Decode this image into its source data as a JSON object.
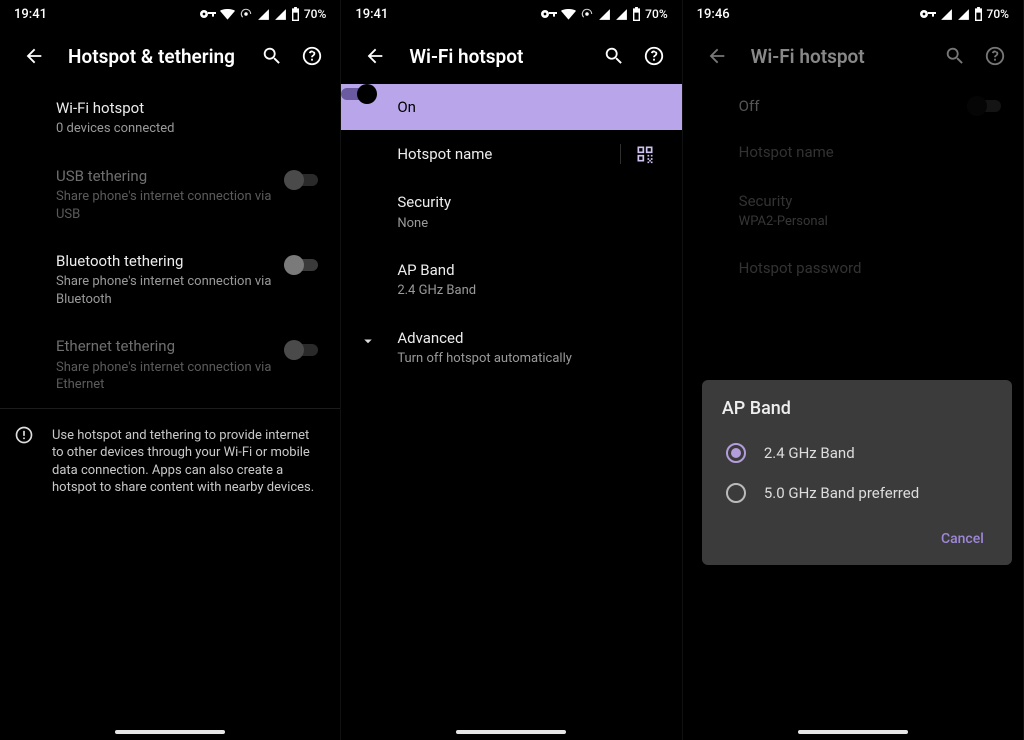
{
  "status_sets": [
    {
      "time": "19:41",
      "battery": "70%",
      "has_vpn": true,
      "has_hotspot": true
    },
    {
      "time": "19:41",
      "battery": "70%",
      "has_vpn": true,
      "has_hotspot": true
    },
    {
      "time": "19:46",
      "battery": "70%",
      "has_vpn": true,
      "has_hotspot": false
    }
  ],
  "screens": [
    {
      "title": "Hotspot & tethering",
      "items": [
        {
          "primary": "Wi-Fi hotspot",
          "secondary": "0 devices connected",
          "hasSwitch": false,
          "disabled": false
        },
        {
          "primary": "USB tethering",
          "secondary": "Share phone's internet connection via USB",
          "hasSwitch": true,
          "switchOn": false,
          "disabled": true
        },
        {
          "primary": "Bluetooth tethering",
          "secondary": "Share phone's internet connection via Bluetooth",
          "hasSwitch": true,
          "switchOn": false,
          "disabled": false
        },
        {
          "primary": "Ethernet tethering",
          "secondary": "Share phone's internet connection via Ethernet",
          "hasSwitch": true,
          "switchOn": false,
          "disabled": true
        }
      ],
      "info_text": "Use hotspot and tethering to provide internet to other devices through your Wi-Fi or mobile data connection. Apps can also create a hotspot to share content with nearby devices."
    },
    {
      "title": "Wi-Fi hotspot",
      "toggle": {
        "label": "On",
        "on": true
      },
      "items": [
        {
          "primary": "Hotspot name",
          "secondary": "",
          "trailing_qr": true
        },
        {
          "primary": "Security",
          "secondary": "None"
        },
        {
          "primary": "AP Band",
          "secondary": "2.4 GHz Band"
        },
        {
          "primary": "Advanced",
          "secondary": "Turn off hotspot automatically",
          "expand": true
        }
      ]
    },
    {
      "title": "Wi-Fi hotspot",
      "toggle": {
        "label": "Off",
        "on": false
      },
      "items": [
        {
          "primary": "Hotspot name",
          "secondary": ""
        },
        {
          "primary": "Security",
          "secondary": "WPA2-Personal"
        },
        {
          "primary": "Hotspot password",
          "secondary": ""
        }
      ],
      "dialog": {
        "title": "AP Band",
        "options": [
          "2.4 GHz Band",
          "5.0 GHz Band preferred"
        ],
        "selected": 0,
        "cancel": "Cancel"
      }
    }
  ]
}
